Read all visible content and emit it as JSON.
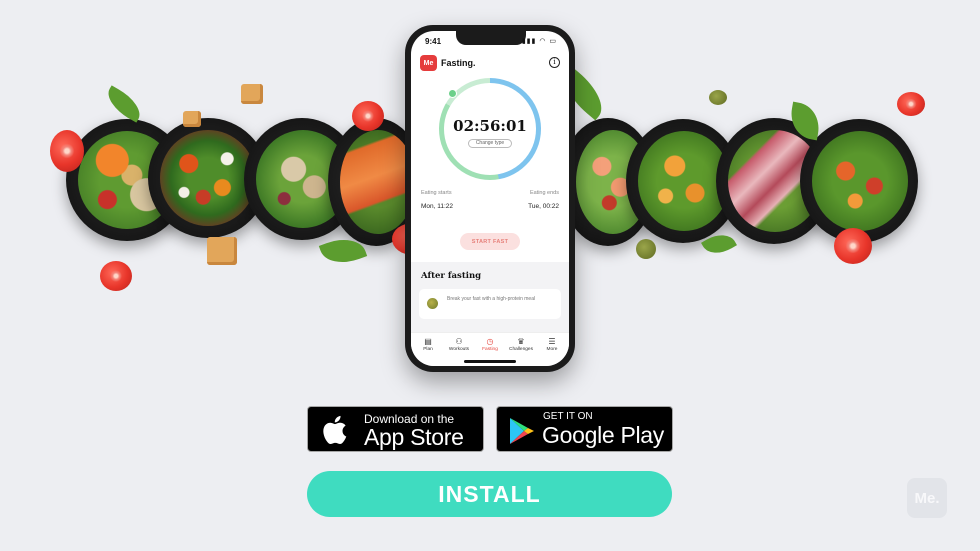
{
  "phone": {
    "status_time": "9:41",
    "status_icons": "▮▮▮ ◠ ▭",
    "logo_text": "Me",
    "app_title": "Fasting.",
    "info_icon": "i",
    "timer": "02:56:01",
    "change_type": "Change type",
    "eating_starts_label": "Eating starts",
    "eating_ends_label": "Eating ends",
    "eating_starts_value": "Mon, 11:22",
    "eating_ends_value": "Tue, 00:22",
    "start_button": "START FAST",
    "after_title": "After fasting",
    "tip_text": "Break your fast with a high-protein meal",
    "tabs": [
      {
        "label": "Plan",
        "icon": "▤"
      },
      {
        "label": "Workouts",
        "icon": "⚇"
      },
      {
        "label": "Fasting",
        "icon": "◷"
      },
      {
        "label": "Challenges",
        "icon": "♛"
      },
      {
        "label": "More",
        "icon": "☰"
      }
    ]
  },
  "badges": {
    "appstore_small": "Download on the",
    "appstore_big": "App Store",
    "google_small": "GET IT ON",
    "google_big": "Google Play"
  },
  "install_label": "INSTALL",
  "corner_logo": "Me.",
  "colors": {
    "accent_install": "#3fdcc0",
    "brand_red": "#e53c3c",
    "background": "#edeef2"
  }
}
